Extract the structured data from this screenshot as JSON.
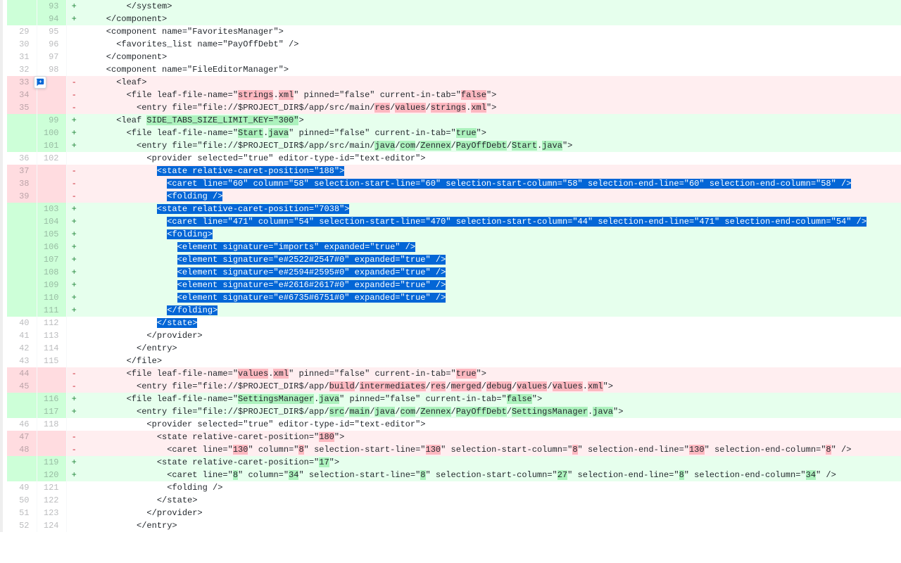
{
  "rows": [
    {
      "type": "add",
      "old": "",
      "new": "93",
      "code": "        </system>"
    },
    {
      "type": "add",
      "old": "",
      "new": "94",
      "code": "    </component>"
    },
    {
      "type": "ctx",
      "old": "29",
      "new": "95",
      "code": "    <component name=\"FavoritesManager\">"
    },
    {
      "type": "ctx",
      "old": "30",
      "new": "96",
      "code": "      <favorites_list name=\"PayOffDebt\" />"
    },
    {
      "type": "ctx",
      "old": "31",
      "new": "97",
      "code": "    </component>"
    },
    {
      "type": "ctx",
      "old": "32",
      "new": "98",
      "code": "    <component name=\"FileEditorManager\">",
      "hasIcon": true
    },
    {
      "type": "del",
      "old": "33",
      "new": "",
      "segs": [
        {
          "t": "      <leaf>"
        }
      ]
    },
    {
      "type": "del",
      "old": "34",
      "new": "",
      "segs": [
        {
          "t": "        <file leaf-file-name=\""
        },
        {
          "t": "strings",
          "c": "hl-del"
        },
        {
          "t": "."
        },
        {
          "t": "xml",
          "c": "hl-del"
        },
        {
          "t": "\" pinned=\"false\" current-in-tab=\""
        },
        {
          "t": "false",
          "c": "hl-del"
        },
        {
          "t": "\">"
        }
      ]
    },
    {
      "type": "del",
      "old": "35",
      "new": "",
      "segs": [
        {
          "t": "          <entry file=\"file://$PROJECT_DIR$/app/src/main/"
        },
        {
          "t": "res",
          "c": "hl-del"
        },
        {
          "t": "/"
        },
        {
          "t": "values",
          "c": "hl-del"
        },
        {
          "t": "/"
        },
        {
          "t": "strings",
          "c": "hl-del"
        },
        {
          "t": "."
        },
        {
          "t": "xml",
          "c": "hl-del"
        },
        {
          "t": "\">"
        }
      ]
    },
    {
      "type": "add",
      "old": "",
      "new": "99",
      "segs": [
        {
          "t": "      <leaf "
        },
        {
          "t": "SIDE_TABS_SIZE_LIMIT_KEY=\"300\"",
          "c": "hl-add"
        },
        {
          "t": ">"
        }
      ]
    },
    {
      "type": "add",
      "old": "",
      "new": "100",
      "segs": [
        {
          "t": "        <file leaf-file-name=\""
        },
        {
          "t": "Start",
          "c": "hl-add"
        },
        {
          "t": "."
        },
        {
          "t": "java",
          "c": "hl-add"
        },
        {
          "t": "\" pinned=\"false\" current-in-tab=\""
        },
        {
          "t": "true",
          "c": "hl-add"
        },
        {
          "t": "\">"
        }
      ]
    },
    {
      "type": "add",
      "old": "",
      "new": "101",
      "segs": [
        {
          "t": "          <entry file=\"file://$PROJECT_DIR$/app/src/main/"
        },
        {
          "t": "java",
          "c": "hl-add"
        },
        {
          "t": "/"
        },
        {
          "t": "com",
          "c": "hl-add"
        },
        {
          "t": "/"
        },
        {
          "t": "Zennex",
          "c": "hl-add"
        },
        {
          "t": "/"
        },
        {
          "t": "PayOffDebt",
          "c": "hl-add"
        },
        {
          "t": "/"
        },
        {
          "t": "Start",
          "c": "hl-add"
        },
        {
          "t": "."
        },
        {
          "t": "java",
          "c": "hl-add"
        },
        {
          "t": "\">"
        }
      ]
    },
    {
      "type": "ctx",
      "old": "36",
      "new": "102",
      "code": "            <provider selected=\"true\" editor-type-id=\"text-editor\">"
    },
    {
      "type": "del",
      "old": "37",
      "new": "",
      "sel": true,
      "segs": [
        {
          "t": "              "
        },
        {
          "t": "<state relative-caret-position=\"",
          "c": "sel"
        },
        {
          "t": "188",
          "c": "sel hl-del"
        },
        {
          "t": "\">",
          "c": "sel"
        }
      ]
    },
    {
      "type": "del",
      "old": "38",
      "new": "",
      "sel": true,
      "segs": [
        {
          "t": "                "
        },
        {
          "t": "<caret line=\"",
          "c": "sel"
        },
        {
          "t": "60",
          "c": "sel hl-del"
        },
        {
          "t": "\" column=\"",
          "c": "sel"
        },
        {
          "t": "58",
          "c": "sel hl-del"
        },
        {
          "t": "\" selection-start-line=\"",
          "c": "sel"
        },
        {
          "t": "60",
          "c": "sel hl-del"
        },
        {
          "t": "\" selection-start-column=\"",
          "c": "sel"
        },
        {
          "t": "58",
          "c": "sel hl-del"
        },
        {
          "t": "\" selection-end-line=\"",
          "c": "sel"
        },
        {
          "t": "60",
          "c": "sel hl-del"
        },
        {
          "t": "\" selection-end-column=\"",
          "c": "sel"
        },
        {
          "t": "58",
          "c": "sel hl-del"
        },
        {
          "t": "\" />",
          "c": "sel"
        }
      ]
    },
    {
      "type": "del",
      "old": "39",
      "new": "",
      "sel": true,
      "segs": [
        {
          "t": "                "
        },
        {
          "t": "<folding />",
          "c": "sel"
        }
      ]
    },
    {
      "type": "add",
      "old": "",
      "new": "103",
      "sel": true,
      "segs": [
        {
          "t": "              "
        },
        {
          "t": "<state relative-caret-position=\"",
          "c": "sel"
        },
        {
          "t": "7038",
          "c": "sel hl-add"
        },
        {
          "t": "\">",
          "c": "sel"
        }
      ]
    },
    {
      "type": "add",
      "old": "",
      "new": "104",
      "sel": true,
      "segs": [
        {
          "t": "                "
        },
        {
          "t": "<caret line=\"",
          "c": "sel"
        },
        {
          "t": "471",
          "c": "sel hl-add"
        },
        {
          "t": "\" column=\"",
          "c": "sel"
        },
        {
          "t": "54",
          "c": "sel hl-add"
        },
        {
          "t": "\" selection-start-line=\"",
          "c": "sel"
        },
        {
          "t": "470",
          "c": "sel hl-add"
        },
        {
          "t": "\" selection-start-column=\"",
          "c": "sel"
        },
        {
          "t": "44",
          "c": "sel hl-add"
        },
        {
          "t": "\" selection-end-line=\"",
          "c": "sel"
        },
        {
          "t": "471",
          "c": "sel hl-add"
        },
        {
          "t": "\" selection-end-column=\"",
          "c": "sel"
        },
        {
          "t": "54",
          "c": "sel hl-add"
        },
        {
          "t": "\" />",
          "c": "sel"
        }
      ]
    },
    {
      "type": "add",
      "old": "",
      "new": "105",
      "sel": true,
      "segs": [
        {
          "t": "                "
        },
        {
          "t": "<folding>",
          "c": "sel"
        }
      ]
    },
    {
      "type": "add",
      "old": "",
      "new": "106",
      "sel": true,
      "segs": [
        {
          "t": "                  "
        },
        {
          "t": "<element signature=\"imports\" expanded=\"true\" />",
          "c": "sel hl-add"
        }
      ]
    },
    {
      "type": "add",
      "old": "",
      "new": "107",
      "sel": true,
      "segs": [
        {
          "t": "                  "
        },
        {
          "t": "<element signature=\"e#2522#2547#0\" expanded=\"true\" />",
          "c": "sel hl-add"
        }
      ]
    },
    {
      "type": "add",
      "old": "",
      "new": "108",
      "sel": true,
      "segs": [
        {
          "t": "                  "
        },
        {
          "t": "<element signature=\"e#2594#2595#0\" expanded=\"true\" />",
          "c": "sel hl-add"
        }
      ]
    },
    {
      "type": "add",
      "old": "",
      "new": "109",
      "sel": true,
      "segs": [
        {
          "t": "                  "
        },
        {
          "t": "<element signature=\"e#2616#2617#0\" expanded=\"true\" />",
          "c": "sel hl-add"
        }
      ]
    },
    {
      "type": "add",
      "old": "",
      "new": "110",
      "sel": true,
      "segs": [
        {
          "t": "                  "
        },
        {
          "t": "<element signature=\"e#6735#6751#0\" expanded=\"true\" />",
          "c": "sel hl-add"
        }
      ]
    },
    {
      "type": "add",
      "old": "",
      "new": "111",
      "sel": true,
      "segs": [
        {
          "t": "                "
        },
        {
          "t": "</folding>",
          "c": "sel"
        }
      ]
    },
    {
      "type": "ctx",
      "old": "40",
      "new": "112",
      "sel": true,
      "segs": [
        {
          "t": "              "
        },
        {
          "t": "</state>",
          "c": "sel"
        }
      ]
    },
    {
      "type": "ctx",
      "old": "41",
      "new": "113",
      "code": "            </provider>"
    },
    {
      "type": "ctx",
      "old": "42",
      "new": "114",
      "code": "          </entry>"
    },
    {
      "type": "ctx",
      "old": "43",
      "new": "115",
      "code": "        </file>"
    },
    {
      "type": "del",
      "old": "44",
      "new": "",
      "segs": [
        {
          "t": "        <file leaf-file-name=\""
        },
        {
          "t": "values",
          "c": "hl-del"
        },
        {
          "t": "."
        },
        {
          "t": "xml",
          "c": "hl-del"
        },
        {
          "t": "\" pinned=\"false\" current-in-tab=\""
        },
        {
          "t": "true",
          "c": "hl-del"
        },
        {
          "t": "\">"
        }
      ]
    },
    {
      "type": "del",
      "old": "45",
      "new": "",
      "segs": [
        {
          "t": "          <entry file=\"file://$PROJECT_DIR$/app/"
        },
        {
          "t": "build",
          "c": "hl-del"
        },
        {
          "t": "/"
        },
        {
          "t": "intermediates",
          "c": "hl-del"
        },
        {
          "t": "/"
        },
        {
          "t": "res",
          "c": "hl-del"
        },
        {
          "t": "/"
        },
        {
          "t": "merged",
          "c": "hl-del"
        },
        {
          "t": "/"
        },
        {
          "t": "debug",
          "c": "hl-del"
        },
        {
          "t": "/"
        },
        {
          "t": "values",
          "c": "hl-del"
        },
        {
          "t": "/"
        },
        {
          "t": "values",
          "c": "hl-del"
        },
        {
          "t": "."
        },
        {
          "t": "xml",
          "c": "hl-del"
        },
        {
          "t": "\">"
        }
      ]
    },
    {
      "type": "add",
      "old": "",
      "new": "116",
      "segs": [
        {
          "t": "        <file leaf-file-name=\""
        },
        {
          "t": "SettingsManager",
          "c": "hl-add"
        },
        {
          "t": "."
        },
        {
          "t": "java",
          "c": "hl-add"
        },
        {
          "t": "\" pinned=\"false\" current-in-tab=\""
        },
        {
          "t": "false",
          "c": "hl-add"
        },
        {
          "t": "\">"
        }
      ]
    },
    {
      "type": "add",
      "old": "",
      "new": "117",
      "segs": [
        {
          "t": "          <entry file=\"file://$PROJECT_DIR$/app/"
        },
        {
          "t": "src",
          "c": "hl-add"
        },
        {
          "t": "/"
        },
        {
          "t": "main",
          "c": "hl-add"
        },
        {
          "t": "/"
        },
        {
          "t": "java",
          "c": "hl-add"
        },
        {
          "t": "/"
        },
        {
          "t": "com",
          "c": "hl-add"
        },
        {
          "t": "/"
        },
        {
          "t": "Zennex",
          "c": "hl-add"
        },
        {
          "t": "/"
        },
        {
          "t": "PayOffDebt",
          "c": "hl-add"
        },
        {
          "t": "/"
        },
        {
          "t": "SettingsManager",
          "c": "hl-add"
        },
        {
          "t": "."
        },
        {
          "t": "java",
          "c": "hl-add"
        },
        {
          "t": "\">"
        }
      ]
    },
    {
      "type": "ctx",
      "old": "46",
      "new": "118",
      "code": "            <provider selected=\"true\" editor-type-id=\"text-editor\">"
    },
    {
      "type": "del",
      "old": "47",
      "new": "",
      "segs": [
        {
          "t": "              <state relative-caret-position=\""
        },
        {
          "t": "180",
          "c": "hl-del"
        },
        {
          "t": "\">"
        }
      ]
    },
    {
      "type": "del",
      "old": "48",
      "new": "",
      "segs": [
        {
          "t": "                <caret line=\""
        },
        {
          "t": "130",
          "c": "hl-del"
        },
        {
          "t": "\" column=\""
        },
        {
          "t": "8",
          "c": "hl-del"
        },
        {
          "t": "\" selection-start-line=\""
        },
        {
          "t": "130",
          "c": "hl-del"
        },
        {
          "t": "\" selection-start-column=\""
        },
        {
          "t": "8",
          "c": "hl-del"
        },
        {
          "t": "\" selection-end-line=\""
        },
        {
          "t": "130",
          "c": "hl-del"
        },
        {
          "t": "\" selection-end-column=\""
        },
        {
          "t": "8",
          "c": "hl-del"
        },
        {
          "t": "\" />"
        }
      ]
    },
    {
      "type": "add",
      "old": "",
      "new": "119",
      "segs": [
        {
          "t": "              <state relative-caret-position=\""
        },
        {
          "t": "17",
          "c": "hl-add"
        },
        {
          "t": "\">"
        }
      ]
    },
    {
      "type": "add",
      "old": "",
      "new": "120",
      "segs": [
        {
          "t": "                <caret line=\""
        },
        {
          "t": "8",
          "c": "hl-add"
        },
        {
          "t": "\" column=\""
        },
        {
          "t": "34",
          "c": "hl-add"
        },
        {
          "t": "\" selection-start-line=\""
        },
        {
          "t": "8",
          "c": "hl-add"
        },
        {
          "t": "\" selection-start-column=\""
        },
        {
          "t": "27",
          "c": "hl-add"
        },
        {
          "t": "\" selection-end-line=\""
        },
        {
          "t": "8",
          "c": "hl-add"
        },
        {
          "t": "\" selection-end-column=\""
        },
        {
          "t": "34",
          "c": "hl-add"
        },
        {
          "t": "\" />"
        }
      ]
    },
    {
      "type": "ctx",
      "old": "49",
      "new": "121",
      "code": "                <folding />"
    },
    {
      "type": "ctx",
      "old": "50",
      "new": "122",
      "code": "              </state>"
    },
    {
      "type": "ctx",
      "old": "51",
      "new": "123",
      "code": "            </provider>"
    },
    {
      "type": "ctx",
      "old": "52",
      "new": "124",
      "code": "          </entry>"
    }
  ]
}
